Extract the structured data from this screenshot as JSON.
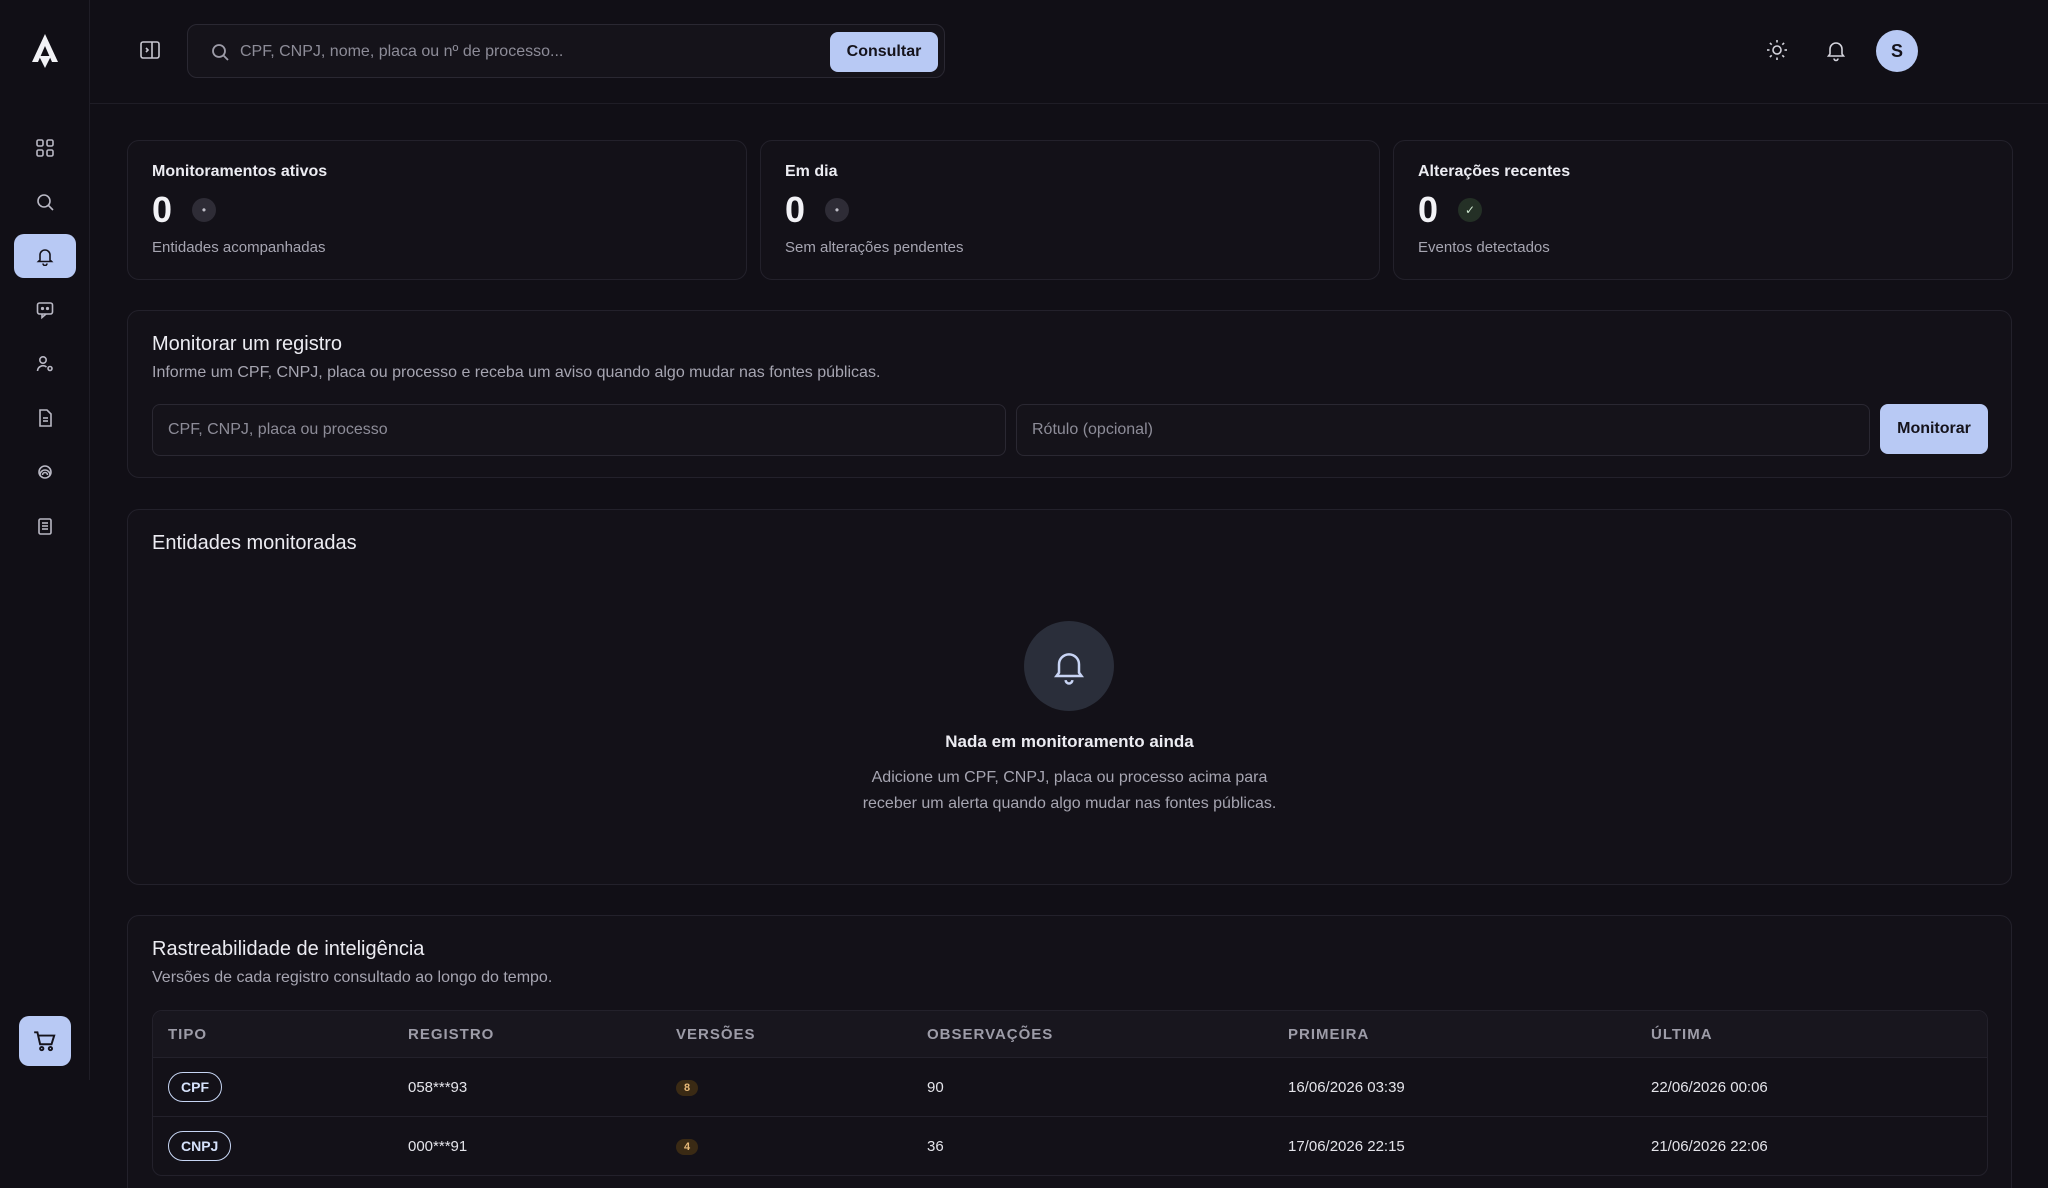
{
  "topbar": {
    "search_placeholder": "CPF, CNPJ, nome, placa ou nº de processo...",
    "consult_label": "Consultar",
    "avatar_initial": "S"
  },
  "sidebar": {
    "items": [
      {
        "icon": "grid-icon",
        "active": false
      },
      {
        "icon": "search-icon",
        "active": false
      },
      {
        "icon": "bell-icon",
        "active": true
      },
      {
        "icon": "chat-icon",
        "active": false
      },
      {
        "icon": "user-gear-icon",
        "active": false
      },
      {
        "icon": "document-icon",
        "active": false
      },
      {
        "icon": "fingerprint-icon",
        "active": false
      },
      {
        "icon": "clipboard-icon",
        "active": false
      }
    ],
    "cart_icon": "cart-icon"
  },
  "stats": [
    {
      "title": "Monitoramentos ativos",
      "value": "0",
      "indicator": "•",
      "sub": "Entidades acompanhadas"
    },
    {
      "title": "Em dia",
      "value": "0",
      "indicator": "•",
      "sub": "Sem alterações pendentes"
    },
    {
      "title": "Alterações recentes",
      "value": "0",
      "indicator": "✓",
      "sub": "Eventos detectados"
    }
  ],
  "monitor": {
    "title": "Monitorar um registro",
    "desc": "Informe um CPF, CNPJ, placa ou processo e receba um aviso quando algo mudar nas fontes públicas.",
    "record_placeholder": "CPF, CNPJ, placa ou processo",
    "label_placeholder": "Rótulo (opcional)",
    "button_label": "Monitorar"
  },
  "entities": {
    "title": "Entidades monitoradas",
    "empty_title": "Nada em monitoramento ainda",
    "empty_desc_1": "Adicione um CPF, CNPJ, placa ou processo acima para",
    "empty_desc_2": "receber um alerta quando algo mudar nas fontes públicas."
  },
  "trace": {
    "title": "Rastreabilidade de inteligência",
    "desc": "Versões de cada registro consultado ao longo do tempo.",
    "columns": [
      "TIPO",
      "REGISTRO",
      "VERSÕES",
      "OBSERVAÇÕES",
      "PRIMEIRA",
      "ÚLTIMA"
    ],
    "rows": [
      {
        "tipo": "CPF",
        "registro": "058***93",
        "versoes": "8",
        "observacoes": "90",
        "primeira": "16/06/2026 03:39",
        "ultima": "22/06/2026 00:06"
      },
      {
        "tipo": "CNPJ",
        "registro": "000***91",
        "versoes": "4",
        "observacoes": "36",
        "primeira": "17/06/2026 22:15",
        "ultima": "21/06/2026 22:06"
      }
    ]
  }
}
